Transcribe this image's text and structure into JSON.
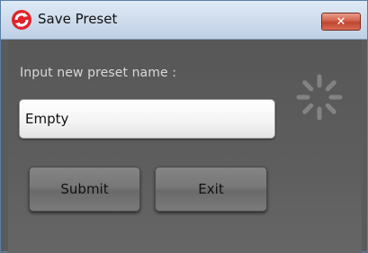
{
  "window": {
    "title": "Save Preset",
    "close_glyph": "✕",
    "icon": "red-circle-arrows-icon"
  },
  "dialog": {
    "prompt_label": "Input new preset name :",
    "name_input_value": "Empty",
    "submit_label": "Submit",
    "exit_label": "Exit",
    "spinner_icon": "loading-spinner-icon"
  },
  "colors": {
    "icon_red": "#e0242b",
    "close_red": "#c84a36",
    "background": "#5b5b5b"
  }
}
